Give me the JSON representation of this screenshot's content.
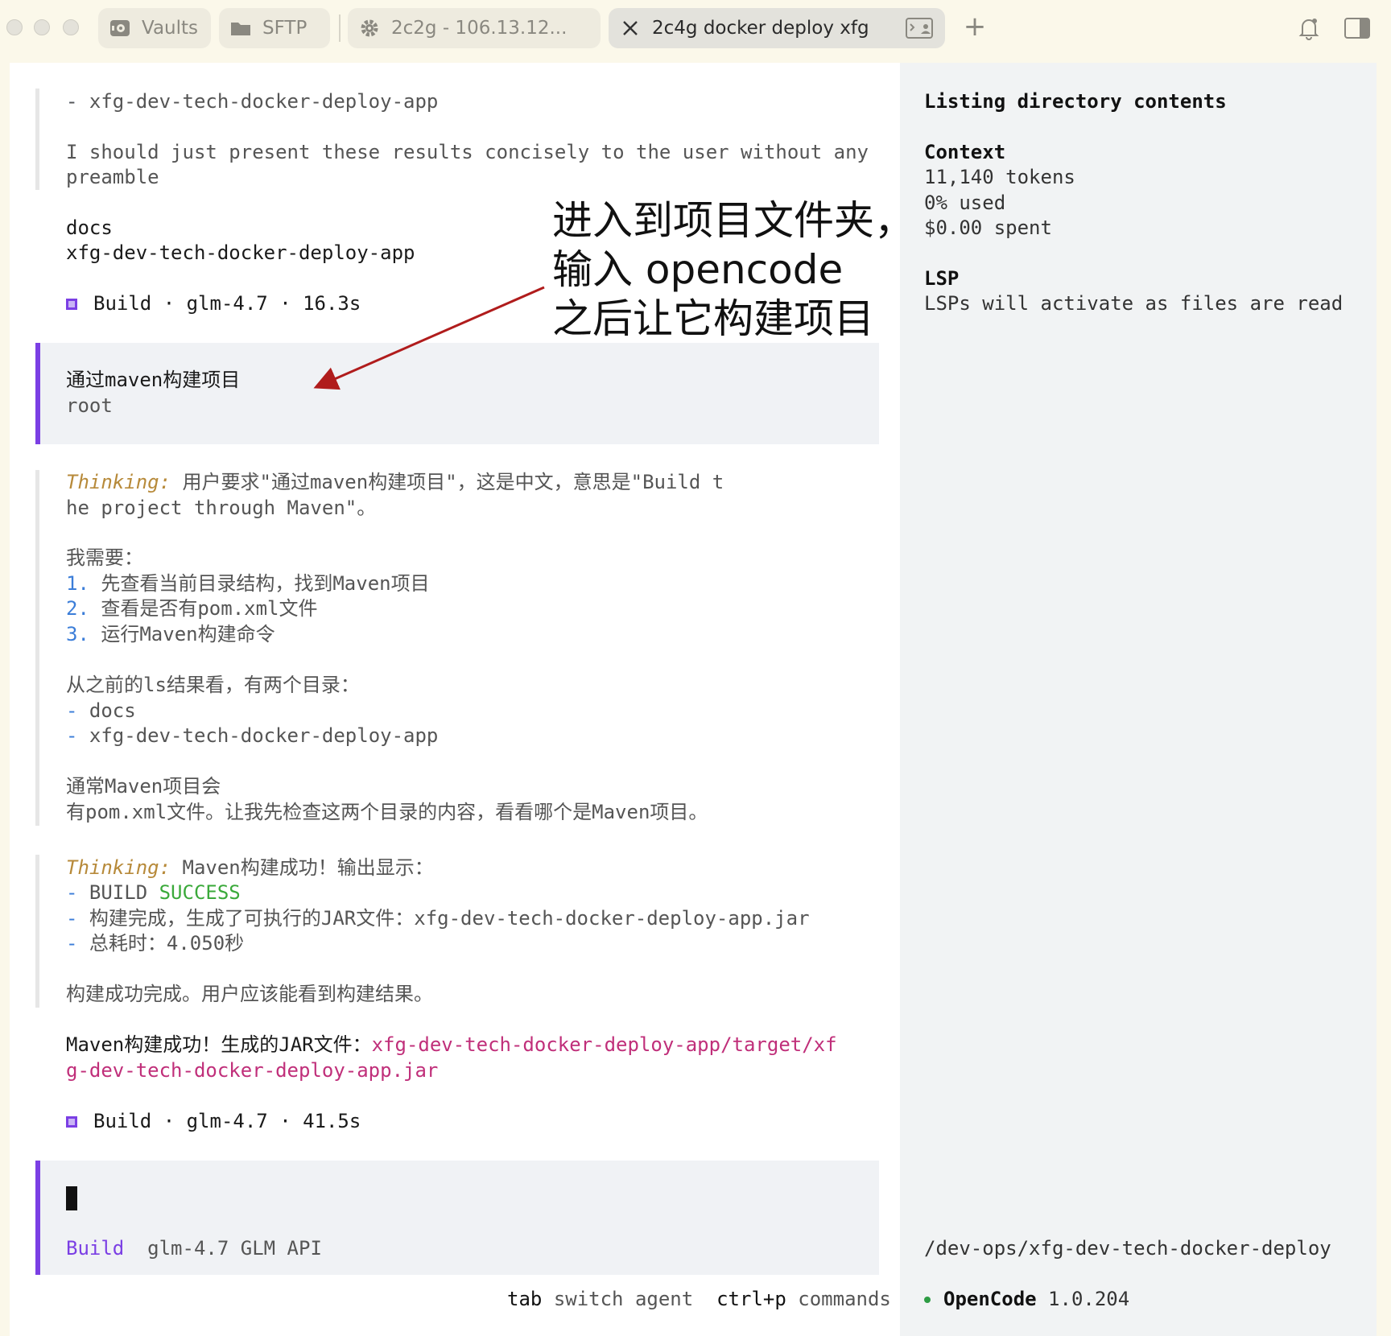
{
  "tabs": [
    {
      "label": "Vaults",
      "icon": "vault-icon"
    },
    {
      "label": "SFTP",
      "icon": "folder-icon"
    },
    {
      "label": "2c2g - 106.13.12...",
      "icon": "gear-icon"
    },
    {
      "label": "2c4g docker deploy xfg",
      "icon": "close-icon",
      "trailing_icon": "terminal-user-icon",
      "active": true
    }
  ],
  "content": {
    "list_item_app": "- xfg-dev-tech-docker-deploy-app",
    "note_line1": "I should just present these results concisely to the user without any",
    "note_line2": "preamble",
    "result_docs": "docs",
    "result_app": "xfg-dev-tech-docker-deploy-app",
    "build1": "Build · glm-4.7 · 16.3s",
    "prompt_text": "通过maven构建项目",
    "prompt_user": "root",
    "thinking_label": "Thinking:",
    "think1_line1": " 用户要求\"通过maven构建项目\"，这是中文，意思是\"Build t",
    "think1_line2": "he project through Maven\"。",
    "need": "我需要：",
    "steps": [
      {
        "num": "1.",
        "text": "先查看当前目录结构，找到Maven项目"
      },
      {
        "num": "2.",
        "text": "查看是否有pom.xml文件"
      },
      {
        "num": "3.",
        "text": "运行Maven构建命令"
      }
    ],
    "from_ls": "从之前的ls结果看，有两个目录：",
    "dirs": [
      "docs",
      "xfg-dev-tech-docker-deploy-app"
    ],
    "usual1": "通常Maven项目会",
    "usual2": "有pom.xml文件。让我先检查这两个目录的内容，看看哪个是Maven项目。",
    "think2": " Maven构建成功！输出显示：",
    "build_prefix": "BUILD ",
    "build_success": "SUCCESS",
    "jar_line": "构建完成，生成了可执行的JAR文件：xfg-dev-tech-docker-deploy-app.jar",
    "time_line": "总耗时：4.050秒",
    "done_line": "构建成功完成。用户应该能看到构建结果。",
    "final_prefix": "Maven构建成功！生成的JAR文件：",
    "final_path1": "xfg-dev-tech-docker-deploy-app/target/xf",
    "final_path2": "g-dev-tech-docker-deploy-app.jar",
    "build2": "Build · glm-4.7 · 41.5s",
    "input_agent": "Build",
    "input_model": "glm-4.7 GLM API",
    "hint_tab_key": "tab",
    "hint_tab_text": "switch agent",
    "hint_cmd_key": "ctrl+p",
    "hint_cmd_text": "commands"
  },
  "annotation": {
    "line1": "进入到项目文件夹，",
    "line2": "输入 opencode",
    "line3": "之后让它构建项目",
    "color": "#b01c1c"
  },
  "sidebar": {
    "title": "Listing directory contents",
    "context_label": "Context",
    "tokens": "11,140 tokens",
    "used": "0% used",
    "spent": "$0.00 spent",
    "lsp_label": "LSP",
    "lsp_text": "LSPs will activate as files are read",
    "path": "/dev-ops/xfg-dev-tech-docker-deploy",
    "app_name": "OpenCode",
    "version": "1.0.204"
  },
  "colors": {
    "accent": "#7b3fe4",
    "success": "#3aa93a",
    "link": "#c02f7a",
    "thinking": "#b78a3a"
  }
}
